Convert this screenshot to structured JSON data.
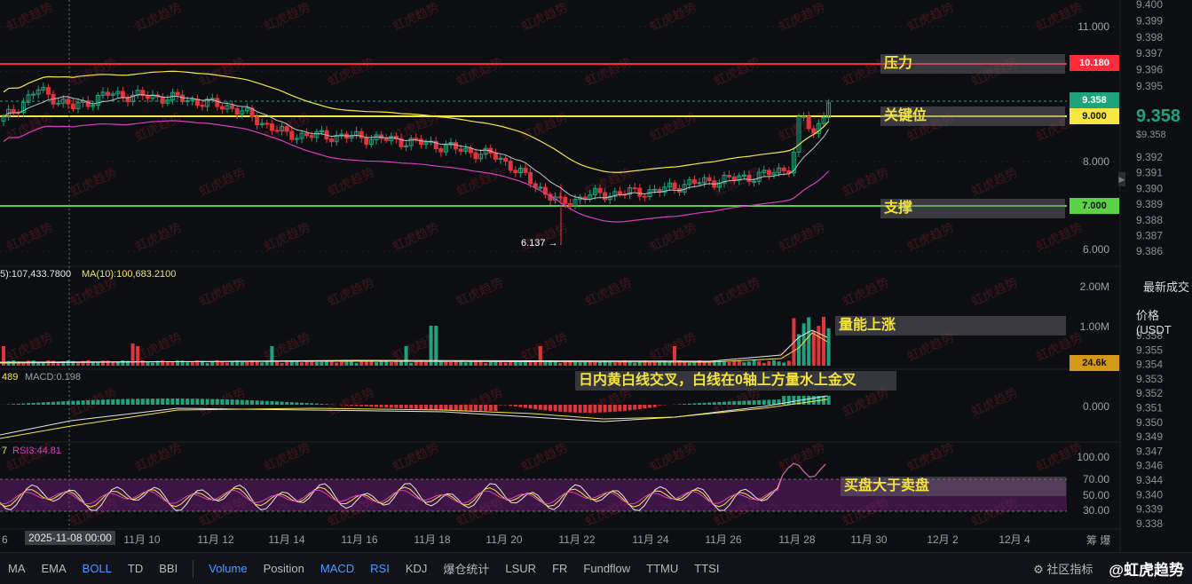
{
  "price_axis": {
    "main_ticks": [
      "11.000",
      "8.000",
      "6.000"
    ],
    "volume_ticks": [
      "2.00M",
      "1.00M"
    ],
    "macd_ticks": [
      "0.000"
    ],
    "rsi_ticks": [
      "100.00",
      "70.00",
      "50.00",
      "30.00"
    ]
  },
  "levels": {
    "pressure": {
      "label": "压力",
      "price": "10.180",
      "color": "#ff2b3a"
    },
    "key": {
      "label": "关键位",
      "price": "9.000",
      "color": "#f5e642"
    },
    "current": {
      "price": "9.358",
      "color": "#1fa37c"
    },
    "support": {
      "label": "支撑",
      "price": "7.000",
      "color": "#5bd146"
    }
  },
  "low_marker": "6.137 →",
  "volume_header": {
    "ma5": "5):107,433.7800",
    "ma10": "MA(10):100,683.2100"
  },
  "volume_tag": "24.6k",
  "macd_header": {
    "left": "489",
    "macd": "MACD:0.198"
  },
  "rsi_header": {
    "left": "7",
    "rsi3": "RSI3:44.81"
  },
  "annotations": {
    "volume": "量能上涨",
    "macd": "日内黄白线交叉，白线在0轴上方量水上金叉",
    "rsi": "买盘大于卖盘"
  },
  "date_axis": {
    "labels": [
      "6",
      "11月 10",
      "11月 12",
      "11月 14",
      "11月 16",
      "11月 18",
      "11月 20",
      "11月 22",
      "11月 24",
      "11月 26",
      "11月 28",
      "11月 30",
      "12月 2",
      "12月 4"
    ],
    "crosshair": "2025-11-08 00:00",
    "right_label": "筹 爆"
  },
  "right_panel": {
    "big_price": "9.358",
    "sub_price": "$9.358",
    "latest_trades": "最新成交",
    "price_header": "价格(USDT",
    "orderbook_top": [
      "9.400",
      "9.399",
      "9.398",
      "9.397",
      "9.396",
      "9.395"
    ],
    "orderbook_bottom": [
      "9.392",
      "9.391",
      "9.390",
      "9.389",
      "9.388",
      "9.387",
      "9.386"
    ],
    "trades": [
      "9.358",
      "9.355",
      "9.354",
      "9.353",
      "9.352",
      "9.351",
      "9.350",
      "9.349",
      "9.347",
      "9.346",
      "9.344",
      "9.340",
      "9.339",
      "9.338"
    ]
  },
  "toolbar": {
    "main_items": [
      "MA",
      "EMA",
      "BOLL",
      "TD",
      "BBI"
    ],
    "sub_items": [
      "Volume",
      "Position",
      "MACD",
      "RSI",
      "KDJ",
      "爆仓统计",
      "LSUR",
      "FR",
      "Fundflow",
      "TTMU",
      "TTSI"
    ],
    "community": "社区指标",
    "brand": "@虹虎趋势"
  },
  "watermark": "虹虎趋势",
  "colors": {
    "up": "#1fa37c",
    "down": "#e0353b",
    "yellow": "#f5e642",
    "white": "#e6e6e6",
    "pink": "#d63fc0"
  }
}
